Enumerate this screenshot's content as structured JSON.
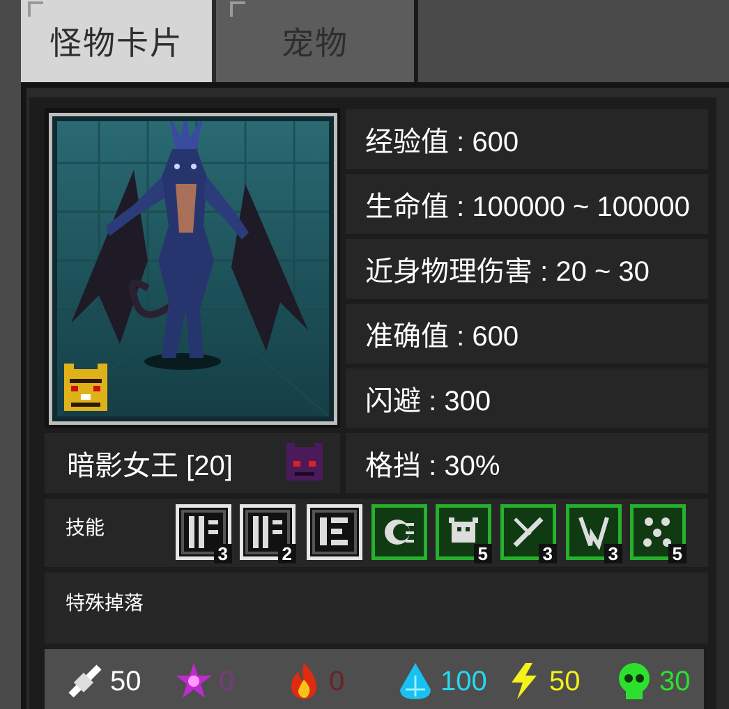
{
  "tabs": {
    "monster_card": "怪物卡片",
    "pet": "宠物"
  },
  "monster": {
    "name": "暗影女王 [20]"
  },
  "stats": {
    "exp": "经验值 : 600",
    "hp": "生命值 : 100000 ~ 100000",
    "melee": "近身物理伤害 : 20 ~ 30",
    "accuracy": "准确值 : 600",
    "evasion": "闪避 : 300",
    "block": "格挡 : 30%"
  },
  "skills_label": "技能",
  "skills": [
    {
      "icon": "rune-skill-icon",
      "count": "3",
      "style": "white"
    },
    {
      "icon": "rune-skill-icon",
      "count": "2",
      "style": "white"
    },
    {
      "icon": "maze-skill-icon",
      "count": "",
      "style": "white"
    },
    {
      "icon": "wind-skill-icon",
      "count": "",
      "style": "green"
    },
    {
      "icon": "beast-skill-icon",
      "count": "5",
      "style": "green"
    },
    {
      "icon": "slash-skill-icon",
      "count": "3",
      "style": "green"
    },
    {
      "icon": "claw-skill-icon",
      "count": "3",
      "style": "green"
    },
    {
      "icon": "scatter-skill-icon",
      "count": "5",
      "style": "green"
    }
  ],
  "drops_label": "特殊掉落",
  "resistances": {
    "physical": "50",
    "arcane": "0",
    "fire": "0",
    "ice": "100",
    "lightning": "50",
    "poison": "30"
  },
  "colors": {
    "physical": "#ffffff",
    "arcane": "#7a3a7a",
    "fire": "#6a2222",
    "ice": "#27d8f0",
    "lightning": "#f4f21a",
    "poison": "#2ee02e"
  }
}
